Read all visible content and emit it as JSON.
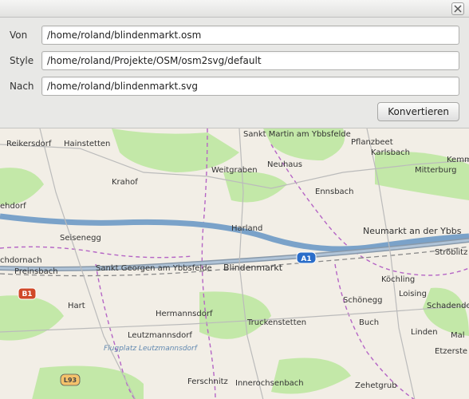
{
  "titlebar": {
    "title": ""
  },
  "form": {
    "von_label": "Von",
    "von_value": "/home/roland/blindenmarkt.osm",
    "style_label": "Style",
    "style_value": "/home/roland/Projekte/OSM/osm2svg/default",
    "nach_label": "Nach",
    "nach_value": "/home/roland/blindenmarkt.svg",
    "convert_label": "Konvertieren"
  },
  "map": {
    "motorway_shield": "A1",
    "primary_shield": "B1",
    "local_shield": "L93",
    "airfield_label": "Flugplatz Leutzmannsdorf",
    "places": {
      "reikersdorf": "Reikersdorf",
      "hainstetten": "Hainstetten",
      "krahof": "Krahof",
      "weitgraben": "Weitgraben",
      "sankt_martin": "Sankt Martin am Ybbsfelde",
      "neuhaus": "Neuhaus",
      "pflanzbeet": "Pflanzbeet",
      "karlsbach": "Karlsbach",
      "mitterburg": "Mitterburg",
      "kemm": "Kemm",
      "ehdorf": "ehdorf",
      "ennsbach": "Ennsbach",
      "seisenegg": "Seisenegg",
      "harland": "Harland",
      "neumarkt": "Neumarkt an der Ybbs",
      "chdornach": "chdornach",
      "preinsbach": "Preinsbach",
      "st_georgen": "Sankt Georgen am Ybbsfelde",
      "blindenmarkt": "Blindenmarkt",
      "koechling": "Köchling",
      "stroeblitz": "Ströblitz",
      "hart": "Hart",
      "hermannsdorf": "Hermannsdorf",
      "schoenegg": "Schönegg",
      "loising": "Loising",
      "schadendorf": "Schadendorf",
      "leutzmannsdorf": "Leutzmannsdorf",
      "truckenstetten": "Truckenstetten",
      "buch": "Buch",
      "linden": "Linden",
      "mal": "Mal",
      "etzerste": "Etzerste",
      "ferschnitz": "Ferschnitz",
      "innerochsenbach": "Innerochsenbach",
      "zehetgrub": "Zehetgrub"
    }
  }
}
